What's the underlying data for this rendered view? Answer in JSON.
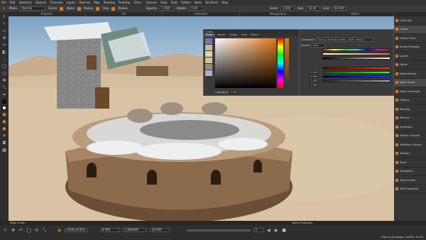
{
  "menubar": [
    "File",
    "Edit",
    "Selection",
    "Objects",
    "Channels",
    "Layers",
    "Patches",
    "Map",
    "Shading",
    "Painting",
    "Filters",
    "Camera",
    "View",
    "Tools",
    "Python",
    "Nuke",
    "DevTools",
    "Help"
  ],
  "toolbar": {
    "mode_label": "Mode",
    "mode_value": "Normal",
    "colors_label": "Colors",
    "alpha_label": "Alpha",
    "radius_label": "Radius",
    "flow_label": "Flow",
    "opacity_label": "Opacity",
    "opacity_value": "1.000",
    "rotate_label": "Rotate",
    "rotate_value": "0.00",
    "scale_label": "Scale",
    "scale_value": "1.000",
    "size_label": "Size",
    "size_value": "16.00",
    "grid_label": "Grid",
    "grid_value": "64.000"
  },
  "viewport_tabs": [
    "Projects",
    "UV",
    "Ortho/UV",
    "Perspective",
    "Ortho"
  ],
  "colors_panel": {
    "title": "Colors",
    "tabs": [
      "Picker",
      "Values",
      "Image",
      "Gray",
      "Blend"
    ],
    "colorspace_label": "Colorspace",
    "colorspace_value": "Same as 8 bit Data (Utility - sRGB - Texture)",
    "format_label": "Format",
    "format_value": "Float",
    "luminance_label": "Luminance",
    "luminance_value": "0.000",
    "values": [
      "0.000",
      "0.000",
      "0.000",
      "0.000"
    ]
  },
  "right_panel": [
    {
      "label": "Channels",
      "active": false
    },
    {
      "label": "Colors",
      "active": true
    },
    {
      "label": "History View",
      "active": false
    },
    {
      "label": "Image Manager",
      "active": false
    },
    {
      "label": "Layers",
      "active": false
    },
    {
      "label": "Lights",
      "active": false
    },
    {
      "label": "Node Render",
      "active": false
    },
    {
      "label": "Node Graph",
      "active": true
    },
    {
      "label": "Node Properties",
      "active": false
    },
    {
      "label": "Objects",
      "active": false
    },
    {
      "label": "Painting",
      "active": false
    },
    {
      "label": "Patches",
      "active": false
    },
    {
      "label": "Projectors",
      "active": false
    },
    {
      "label": "Python Console",
      "active": false
    },
    {
      "label": "Selection Groups",
      "active": false
    },
    {
      "label": "Shaders",
      "active": false
    },
    {
      "label": "Shelf",
      "active": false
    },
    {
      "label": "Snapshots",
      "active": false
    },
    {
      "label": "Texture Sets",
      "active": false
    },
    {
      "label": "Tool Properties",
      "active": false
    }
  ],
  "status": {
    "left": "Node Graph",
    "right": "Node Properties",
    "cache": "Disk Cache Usage: 1.64GB / 50 GB"
  },
  "bottom_tools": {
    "color_space": "sRGB (ACES)",
    "field1": "1.000000",
    "field2": "8.000",
    "field3": "16.000",
    "field4": "1.000",
    "field5": "1.000000",
    "frame": "1"
  },
  "icons": {
    "color_accent": "#e07a1a",
    "panel_bg": "#3a3a3a"
  }
}
